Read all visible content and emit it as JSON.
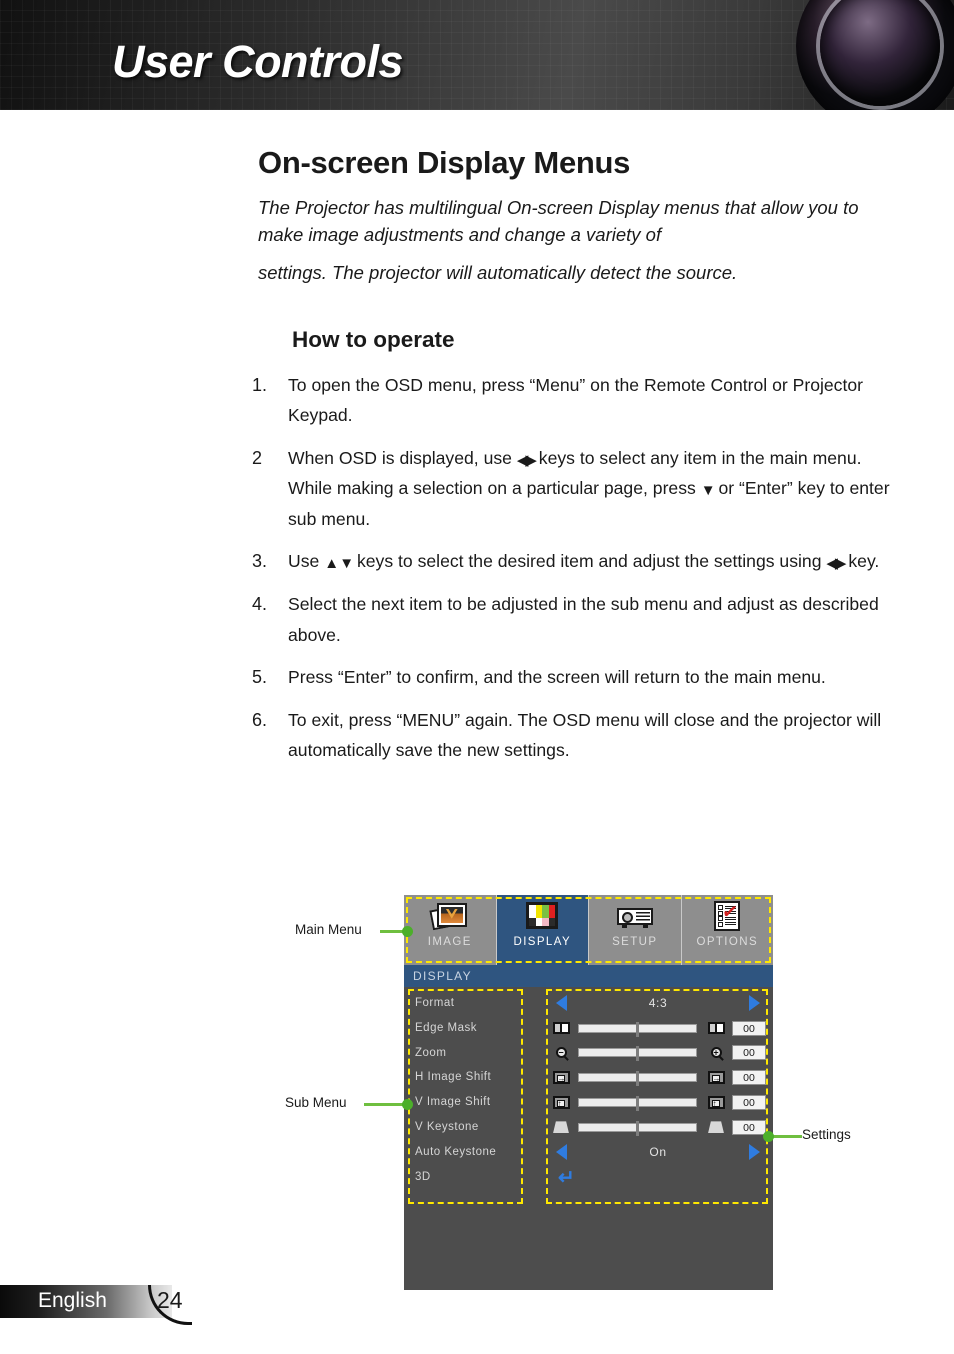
{
  "header": {
    "title": "User Controls"
  },
  "page": {
    "title": "On-screen Display Menus",
    "intro_line1": "The Projector has multilingual On-screen Display menus that allow you to make image adjustments and change a variety of",
    "intro_line2": "settings. The projector will automatically detect the source.",
    "section_title": "How to operate"
  },
  "steps": [
    {
      "num": "1.",
      "text_a": "To open the OSD menu, press “Menu” on the Remote Control or Projector Keypad.",
      "text_b": "",
      "text_c": ""
    },
    {
      "num": "2",
      "text_a": "When OSD is displayed, use ",
      "icon_a": "left-right-arrows",
      "text_b": " keys to select any item in the main menu. While making a selection on a particular page, press ",
      "icon_b": "down-arrow",
      "text_c": " or “Enter” key to enter sub menu."
    },
    {
      "num": "3.",
      "text_a": "Use ",
      "icon_a": "up-down-arrows",
      "text_b": " keys to select the desired item and adjust the settings using ",
      "icon_b": "left-right-arrows",
      "text_c": " key."
    },
    {
      "num": "4.",
      "text_a": "Select the next item to be adjusted in the sub menu and adjust as described above.",
      "text_b": "",
      "text_c": ""
    },
    {
      "num": "5.",
      "text_a": "Press “Enter” to confirm, and the screen will return to the main menu.",
      "text_b": "",
      "text_c": ""
    },
    {
      "num": "6.",
      "text_a": "To exit, press “MENU” again. The OSD menu will close and the projector will automatically save the new settings.",
      "text_b": "",
      "text_c": ""
    }
  ],
  "osd": {
    "title_bar": "DISPLAY",
    "tabs": [
      {
        "label": "IMAGE",
        "icon": "photo-stack-icon",
        "active": false
      },
      {
        "label": "DISPLAY",
        "icon": "color-bars-icon",
        "active": true
      },
      {
        "label": "SETUP",
        "icon": "projector-icon",
        "active": false
      },
      {
        "label": "OPTIONS",
        "icon": "checklist-icon",
        "active": false
      }
    ],
    "submenu_items": [
      "Format",
      "Edge Mask",
      "Zoom",
      "H Image Shift",
      "V Image Shift",
      "V Keystone",
      "Auto Keystone",
      "3D"
    ],
    "settings": {
      "format_value": "4:3",
      "sliders": [
        {
          "icon_left": "edge-mask-icon",
          "icon_right": "edge-mask-icon",
          "value": "00"
        },
        {
          "icon_left": "zoom-out-icon",
          "icon_right": "zoom-in-icon",
          "value": "00"
        },
        {
          "icon_left": "h-shift-icon",
          "icon_right": "h-shift-icon",
          "value": "00"
        },
        {
          "icon_left": "v-shift-icon",
          "icon_right": "v-shift-icon",
          "value": "00"
        },
        {
          "icon_left": "keystone-icon",
          "icon_right": "keystone-icon",
          "value": "00"
        }
      ],
      "auto_keystone_value": "On",
      "enter_glyph": "↵"
    },
    "callouts": {
      "main_menu": "Main Menu",
      "sub_menu": "Sub Menu",
      "settings": "Settings"
    },
    "colors": {
      "panel_bg": "#4d4d4d",
      "tab_bg": "#8e8e8e",
      "tab_active": "#2f5580",
      "highlight_dash": "#ffe800",
      "arrow_blue": "#2f7ce0",
      "callout_green": "#6fbf3f"
    }
  },
  "footer": {
    "language": "English",
    "page_number": "24"
  }
}
